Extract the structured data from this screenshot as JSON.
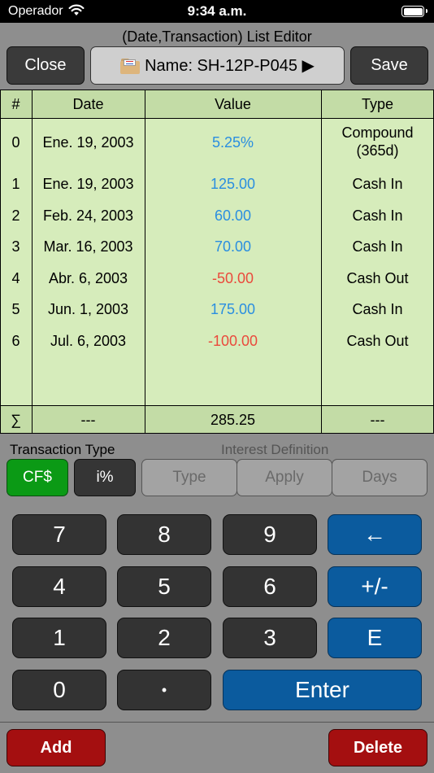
{
  "status_bar": {
    "carrier": "Operador",
    "time": "9:34 a.m."
  },
  "editor": {
    "title": "(Date,Transaction) List Editor",
    "close_label": "Close",
    "name_label": "Name: SH-12P-P045 ▶",
    "save_label": "Save"
  },
  "table": {
    "headers": [
      "#",
      "Date",
      "Value",
      "Type"
    ],
    "rows": [
      {
        "index": "0",
        "date": "Ene. 19, 2003",
        "value": "5.25%",
        "type": "Compound (365d)",
        "sign": "pos"
      },
      {
        "index": "1",
        "date": "Ene. 19, 2003",
        "value": "125.00",
        "type": "Cash In",
        "sign": "pos"
      },
      {
        "index": "2",
        "date": "Feb. 24, 2003",
        "value": "60.00",
        "type": "Cash In",
        "sign": "pos"
      },
      {
        "index": "3",
        "date": "Mar. 16, 2003",
        "value": "70.00",
        "type": "Cash In",
        "sign": "pos"
      },
      {
        "index": "4",
        "date": "Abr. 6, 2003",
        "value": "-50.00",
        "type": "Cash Out",
        "sign": "neg"
      },
      {
        "index": "5",
        "date": "Jun. 1, 2003",
        "value": "175.00",
        "type": "Cash In",
        "sign": "pos"
      },
      {
        "index": "6",
        "date": "Jul. 6, 2003",
        "value": "-100.00",
        "type": "Cash Out",
        "sign": "neg"
      }
    ],
    "sum": {
      "symbol": "∑",
      "date": "---",
      "value": "285.25",
      "type": "---"
    }
  },
  "transaction_type": {
    "label": "Transaction Type",
    "cf_label": "CF$",
    "ip_label": "i%"
  },
  "interest_definition": {
    "label": "Interest Definition",
    "type_label": "Type",
    "apply_label": "Apply",
    "days_label": "Days"
  },
  "keypad": {
    "k7": "7",
    "k8": "8",
    "k9": "9",
    "back": "←",
    "k4": "4",
    "k5": "5",
    "k6": "6",
    "sign": "+/-",
    "k1": "1",
    "k2": "2",
    "k3": "3",
    "exp": "E",
    "k0": "0",
    "dot": "•",
    "enter": "Enter"
  },
  "actions": {
    "add_label": "Add",
    "delete_label": "Delete"
  },
  "colors": {
    "background": "#8e8e8e",
    "table_bg": "#d6ecbb",
    "positive_value": "#2a8ee0",
    "negative_value": "#ea4a3c",
    "cf_active": "#0b9a15",
    "key_blue": "#0b5b9e",
    "action_red": "#a40f10"
  }
}
